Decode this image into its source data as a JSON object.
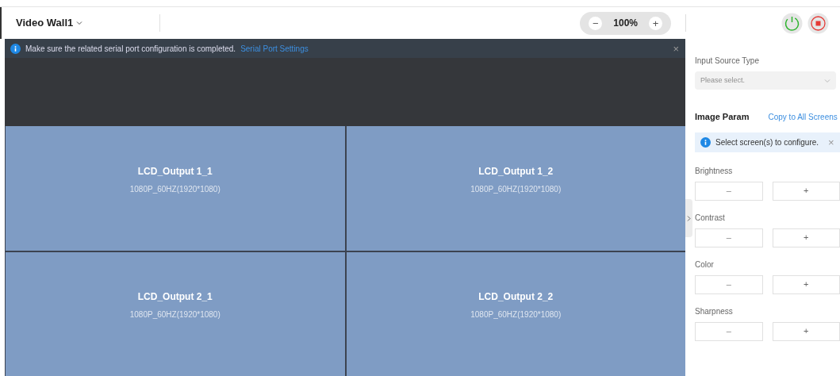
{
  "toolbar": {
    "wall_name": "Video Wall1",
    "zoom": {
      "minus": "−",
      "value": "100%",
      "plus": "+"
    }
  },
  "banner": {
    "message": "Make sure the related serial port configuration is completed.",
    "link": "Serial Port Settings",
    "close": "×"
  },
  "screens": [
    {
      "name": "LCD_Output 1_1",
      "resolution": "1080P_60HZ(1920*1080)"
    },
    {
      "name": "LCD_Output 1_2",
      "resolution": "1080P_60HZ(1920*1080)"
    },
    {
      "name": "LCD_Output 2_1",
      "resolution": "1080P_60HZ(1920*1080)"
    },
    {
      "name": "LCD_Output 2_2",
      "resolution": "1080P_60HZ(1920*1080)"
    }
  ],
  "panel": {
    "input_source_label": "Input Source Type",
    "input_source_placeholder": "Please select.",
    "image_param_title": "Image Param",
    "copy_link": "Copy to All Screens",
    "hint": "Select screen(s) to configure.",
    "hint_close": "×",
    "params": [
      {
        "label": "Brightness",
        "minus": "–",
        "plus": "+"
      },
      {
        "label": "Contrast",
        "minus": "–",
        "plus": "+"
      },
      {
        "label": "Color",
        "minus": "–",
        "plus": "+"
      },
      {
        "label": "Sharpness",
        "minus": "–",
        "plus": "+"
      }
    ]
  }
}
